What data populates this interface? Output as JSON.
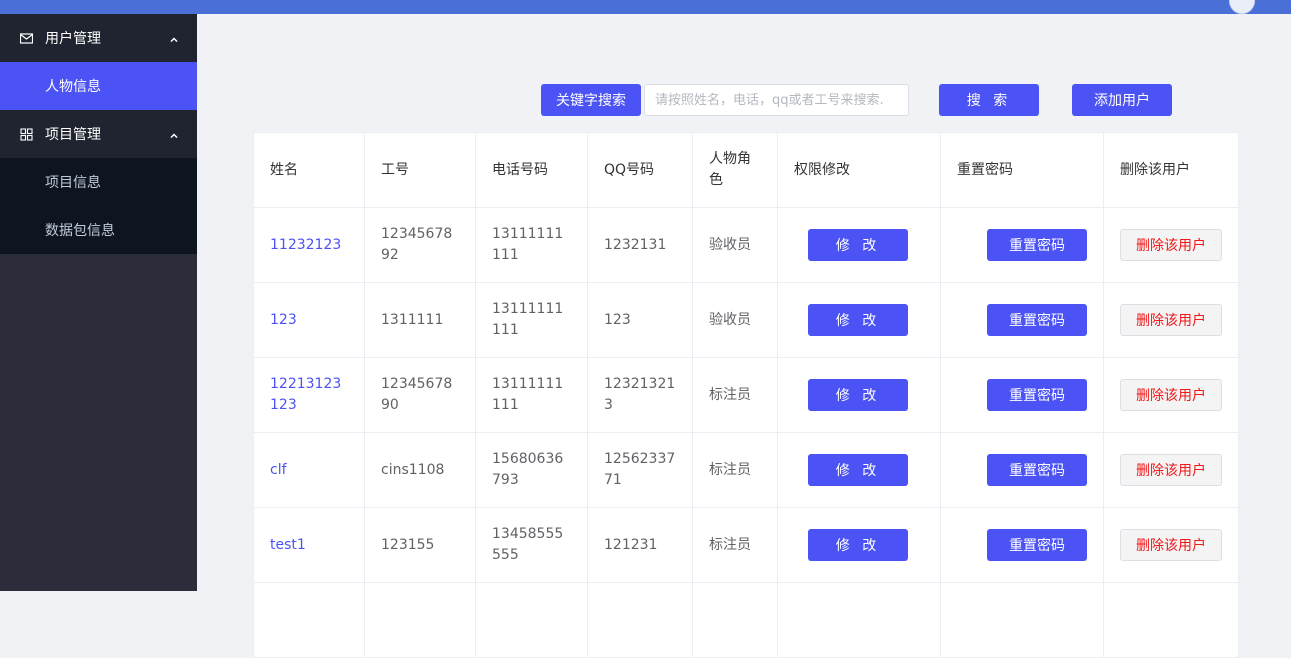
{
  "sidebar": {
    "groups": [
      {
        "label": "用户管理",
        "icon": "mail-icon",
        "items": [
          {
            "label": "人物信息",
            "active": true
          }
        ]
      },
      {
        "label": "项目管理",
        "icon": "grid-icon",
        "items": [
          {
            "label": "项目信息",
            "active": false
          },
          {
            "label": "数据包信息",
            "active": false
          }
        ]
      }
    ]
  },
  "toolbar": {
    "keyword_label": "关键字搜索",
    "search_placeholder": "请按照姓名，电话，qq或者工号来搜索.",
    "search_label": "搜 索",
    "add_label": "添加用户"
  },
  "table": {
    "headers": [
      "姓名",
      "工号",
      "电话号码",
      "QQ号码",
      "人物角色",
      "权限修改",
      "重置密码",
      "删除该用户"
    ],
    "rows": [
      {
        "name": "11232123",
        "id": "1234567892",
        "phone": "13111111111",
        "qq": "1232131",
        "role": "验收员"
      },
      {
        "name": "123",
        "id": "1311111",
        "phone": "13111111111",
        "qq": "123",
        "role": "验收员"
      },
      {
        "name": "12213123123",
        "id": "1234567890",
        "phone": "13111111111",
        "qq": "123213213",
        "role": "标注员"
      },
      {
        "name": "clf",
        "id": "cins1108",
        "phone": "15680636793",
        "qq": "1256233771",
        "role": "标注员"
      },
      {
        "name": "test1",
        "id": "123155",
        "phone": "13458555555",
        "qq": "121231",
        "role": "标注员"
      }
    ],
    "edit_label": "修 改",
    "reset_label": "重置密码",
    "delete_label": "删除该用户"
  },
  "colors": {
    "accent": "#4b53f4",
    "topbar": "#4a6fd6",
    "sidebar": "#2b2e3a",
    "danger": "#f01818"
  }
}
